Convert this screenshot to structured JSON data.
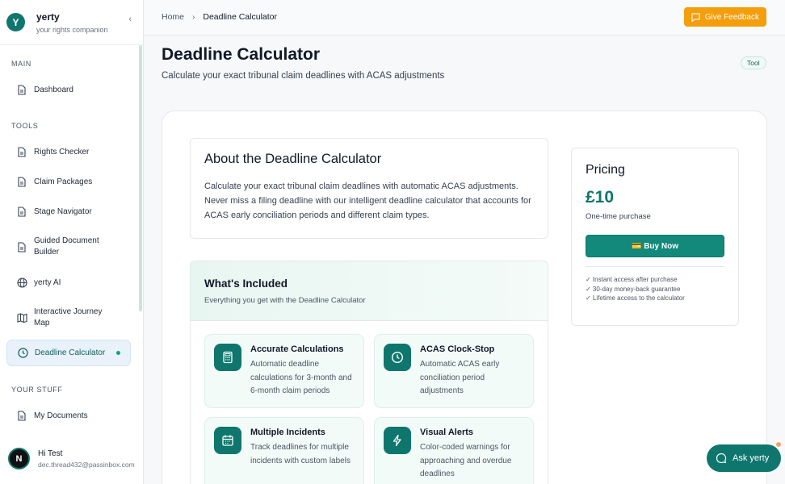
{
  "brand": {
    "name": "yerty",
    "tagline": "your rights companion",
    "logo_letter": "Y"
  },
  "sidebar": {
    "sections": {
      "main": "MAIN",
      "tools": "TOOLS",
      "your_stuff": "YOUR STUFF"
    },
    "items": [
      {
        "label": "Dashboard",
        "icon": "document-icon"
      },
      {
        "label": "Rights Checker",
        "icon": "document-icon"
      },
      {
        "label": "Claim Packages",
        "icon": "document-icon"
      },
      {
        "label": "Stage Navigator",
        "icon": "document-icon"
      },
      {
        "label": "Guided Document Builder",
        "icon": "document-icon"
      },
      {
        "label": "yerty AI",
        "icon": "globe-icon"
      },
      {
        "label": "Interactive Journey Map",
        "icon": "map-icon"
      },
      {
        "label": "Deadline Calculator",
        "icon": "clock-icon",
        "active": true
      },
      {
        "label": "My Documents",
        "icon": "document-icon"
      }
    ],
    "user": {
      "avatar_letter": "N",
      "name": "Hi Test",
      "email": "dec.thread432@passinbox.com"
    }
  },
  "topbar": {
    "breadcrumb": {
      "home": "Home",
      "current": "Deadline Calculator"
    },
    "feedback_label": "Give Feedback"
  },
  "header": {
    "title": "Deadline Calculator",
    "subtitle": "Calculate your exact tribunal claim deadlines with ACAS adjustments",
    "badge": "Tool"
  },
  "about": {
    "title": "About the Deadline Calculator",
    "body": "Calculate your exact tribunal claim deadlines with automatic ACAS adjustments. Never miss a filing deadline with our intelligent deadline calculator that accounts for ACAS early conciliation periods and different claim types."
  },
  "included": {
    "title": "What's Included",
    "subtitle": "Everything you get with the Deadline Calculator",
    "features": [
      {
        "title": "Accurate Calculations",
        "desc": "Automatic deadline calculations for 3-month and 6-month claim periods",
        "icon": "calculator-icon"
      },
      {
        "title": "ACAS Clock-Stop",
        "desc": "Automatic ACAS early conciliation period adjustments",
        "icon": "clock-icon"
      },
      {
        "title": "Multiple Incidents",
        "desc": "Track deadlines for multiple incidents with custom labels",
        "icon": "calendar-icon"
      },
      {
        "title": "Visual Alerts",
        "desc": "Color-coded warnings for approaching and overdue deadlines",
        "icon": "lightning-icon"
      }
    ]
  },
  "pricing": {
    "title": "Pricing",
    "price": "£10",
    "note": "One-time purchase",
    "buy_label": "💳 Buy Now",
    "perks": [
      "✓ Instant access after purchase",
      "✓ 30-day money-back guarantee",
      "✓ Lifetime access to the calculator"
    ]
  },
  "assistant": {
    "label": "Ask yerty"
  },
  "colors": {
    "accent": "#0f766e",
    "feedback": "#f59e0b"
  }
}
